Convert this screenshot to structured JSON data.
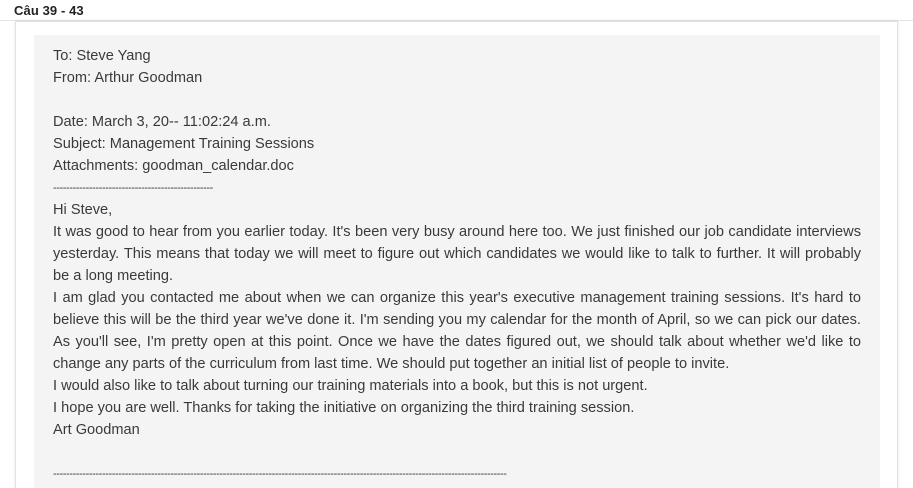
{
  "header": {
    "title": "Câu 39 - 43"
  },
  "email": {
    "to": "To: Steve Yang",
    "from": "From: Arthur Goodman",
    "date": "Date: March 3, 20-- 11:02:24 a.m.",
    "subject": "Subject: Management Training Sessions",
    "attachments": "Attachments: goodman_calendar.doc",
    "separator_top": "-------------------------------------------------",
    "greeting": "Hi Steve,",
    "paragraphs": [
      "It was good to hear from you earlier today. It's been very busy around here too. We just finished our job candidate interviews yesterday. This means that today we will meet to figure out which candidates we would like to talk to further. It will probably be a long meeting.",
      "I am glad you contacted me about when we can organize this year's executive management training sessions. It's hard to believe this will be the third year we've done it. I'm sending you my calendar for the month of April, so we can pick our dates. As you'll see, I'm pretty open at this point. Once we have the dates figured out, we should talk about whether we'd like to change any parts of the curriculum from last time. We should put together an initial list of people to invite.",
      "I would also like to talk about turning our training materials into a book, but this is not urgent.",
      "I hope you are well. Thanks for taking the initiative on organizing the third training session."
    ],
    "signature": "Art Goodman",
    "separator_bottom": "-------------------------------------------------------------------------------------------------------------------------------------------"
  }
}
